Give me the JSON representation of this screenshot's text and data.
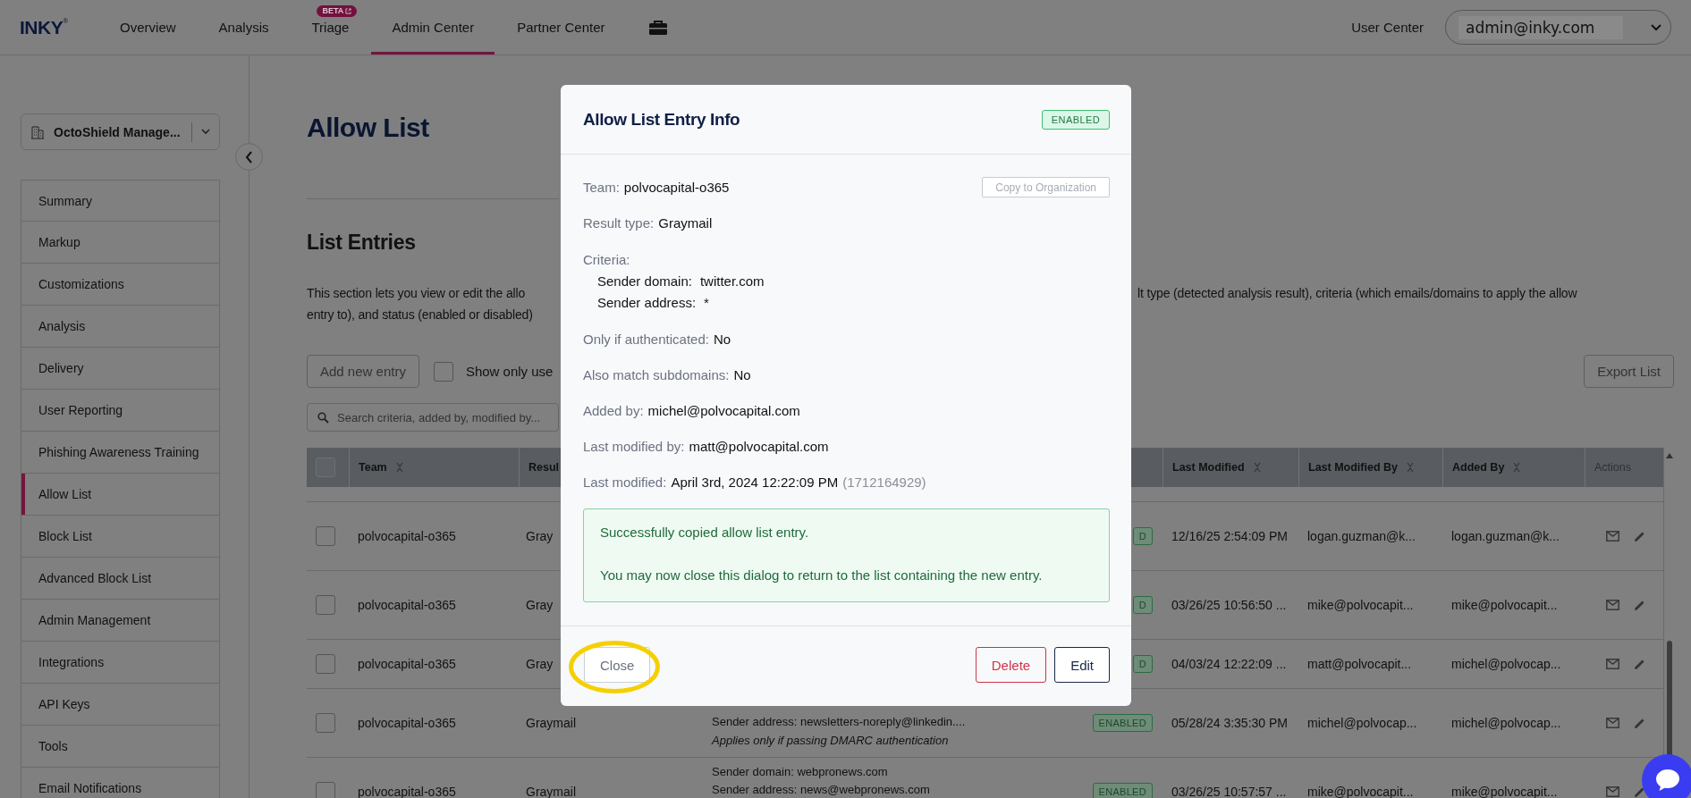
{
  "nav": {
    "logo": "INKY",
    "logo_mark": "®",
    "items": [
      {
        "label": "Overview",
        "selected": false
      },
      {
        "label": "Analysis",
        "selected": false
      },
      {
        "label": "Triage",
        "selected": false,
        "badge": "BETA"
      },
      {
        "label": "Admin Center",
        "selected": true
      },
      {
        "label": "Partner Center",
        "selected": false
      }
    ],
    "user_center": "User Center",
    "account": "admin@inky.com"
  },
  "sidebar": {
    "org_selector": "OctoShield Manage...",
    "items": [
      {
        "label": "Summary",
        "selected": false
      },
      {
        "label": "Markup",
        "selected": false
      },
      {
        "label": "Customizations",
        "selected": false
      },
      {
        "label": "Analysis",
        "selected": false
      },
      {
        "label": "Delivery",
        "selected": false
      },
      {
        "label": "User Reporting",
        "selected": false
      },
      {
        "label": "Phishing Awareness Training",
        "selected": false
      },
      {
        "label": "Allow List",
        "selected": true
      },
      {
        "label": "Block List",
        "selected": false
      },
      {
        "label": "Advanced Block List",
        "selected": false
      },
      {
        "label": "Admin Management",
        "selected": false
      },
      {
        "label": "Integrations",
        "selected": false
      },
      {
        "label": "API Keys",
        "selected": false
      },
      {
        "label": "Tools",
        "selected": false
      },
      {
        "label": "Email Notifications",
        "selected": false
      }
    ]
  },
  "page": {
    "title": "Allow List",
    "section_title": "List Entries",
    "description_left": [
      "This section lets you view or edit the allo",
      "entry to), and status (enabled or disabled)"
    ],
    "description_right": [
      "lt type (detected analysis result), criteria (which emails/domains to apply the allow"
    ],
    "add_button": "Add new entry",
    "filter_checkbox": {
      "label": "Show only use",
      "checked": false
    },
    "export_button": "Export List",
    "search": {
      "placeholder": "Search criteria, added by, modified by..."
    }
  },
  "table": {
    "all_selected": false,
    "columns_left": [
      {
        "label": "Team",
        "sortable": true
      },
      {
        "label": "Resul",
        "sortable": false
      }
    ],
    "columns_right": [
      {
        "label": "Last Modified",
        "sortable": true
      },
      {
        "label": "Last Modified By",
        "sortable": true
      },
      {
        "label": "Added By",
        "sortable": true
      },
      {
        "label": "Actions",
        "sortable": false
      }
    ],
    "rows": [
      {
        "selected": false,
        "team": "polvocapital-o365",
        "result": "Gray",
        "status": {
          "label": "D",
          "enabled": true
        },
        "last_modified": "12/16/25 2:54:09 PM",
        "last_modified_by": "logan.guzman@k...",
        "added_by": "logan.guzman@k..."
      },
      {
        "selected": false,
        "team": "polvocapital-o365",
        "result": "Gray",
        "status": {
          "label": "D",
          "enabled": true
        },
        "last_modified": "03/26/25 10:56:50 ...",
        "last_modified_by": "mike@polvocapit...",
        "added_by": "mike@polvocapit..."
      },
      {
        "selected": false,
        "team": "polvocapital-o365",
        "result": "Gray",
        "status": {
          "label": "D",
          "enabled": true
        },
        "last_modified": "04/03/24 12:22:09 ...",
        "last_modified_by": "matt@polvocapit...",
        "added_by": "michel@polvocap..."
      },
      {
        "selected": false,
        "team": "polvocapital-o365",
        "result": "Graymail",
        "criteria": [
          {
            "kind": "rule",
            "text": "Sender address: newsletters-noreply@linkedin...."
          },
          {
            "kind": "note",
            "text": "Applies only if passing DMARC authentication"
          }
        ],
        "status": {
          "label": "ENABLED",
          "enabled": true
        },
        "last_modified": "05/28/24 3:35:30 PM",
        "last_modified_by": "michel@polvocap...",
        "added_by": "michel@polvocap..."
      },
      {
        "selected": false,
        "team": "polvocapital-o365",
        "result": "Graymail",
        "criteria": [
          {
            "kind": "rule",
            "text": "Sender domain: webpronews.com"
          },
          {
            "kind": "rule",
            "text": "Sender address: news@webpronews.com"
          }
        ],
        "status": {
          "label": "ENABLED",
          "enabled": true
        },
        "last_modified": "03/26/25 10:57:57 ...",
        "last_modified_by": "mike@polvocapit...",
        "added_by": "mike@polvocapit..."
      }
    ]
  },
  "modal": {
    "title": "Allow List Entry Info",
    "status": {
      "label": "ENABLED",
      "enabled": true
    },
    "fields": [
      {
        "kind": "field",
        "label": "Team:",
        "value": "polvocapital-o365",
        "action": {
          "label": "Copy to Organization",
          "disabled": true
        }
      },
      {
        "kind": "field",
        "label": "Result type:",
        "value": "Graymail"
      },
      {
        "kind": "group",
        "label": "Criteria:",
        "lines": [
          {
            "label": "Sender domain:",
            "value": "twitter.com"
          },
          {
            "label": "Sender address:",
            "value": "*"
          }
        ]
      },
      {
        "kind": "field",
        "label": "Only if authenticated:",
        "value": "No"
      },
      {
        "kind": "field",
        "label": "Also match subdomains:",
        "value": "No"
      },
      {
        "kind": "field",
        "label": "Added by:",
        "value": "michel@polvocapital.com"
      },
      {
        "kind": "field",
        "label": "Last modified by:",
        "value": "matt@polvocapital.com"
      },
      {
        "kind": "field",
        "label": "Last modified:",
        "value": "April 3rd, 2024 12:22:09 PM",
        "note": "(1712164929)"
      }
    ],
    "alert": [
      "Successfully copied allow list entry.",
      "You may now close this dialog to return to the list containing the new entry."
    ],
    "buttons": [
      {
        "label": "Close",
        "kind": "secondary",
        "highlighted": true
      },
      {
        "label": "Delete",
        "kind": "danger",
        "highlighted": false
      },
      {
        "label": "Edit",
        "kind": "primary",
        "highlighted": false
      }
    ]
  }
}
